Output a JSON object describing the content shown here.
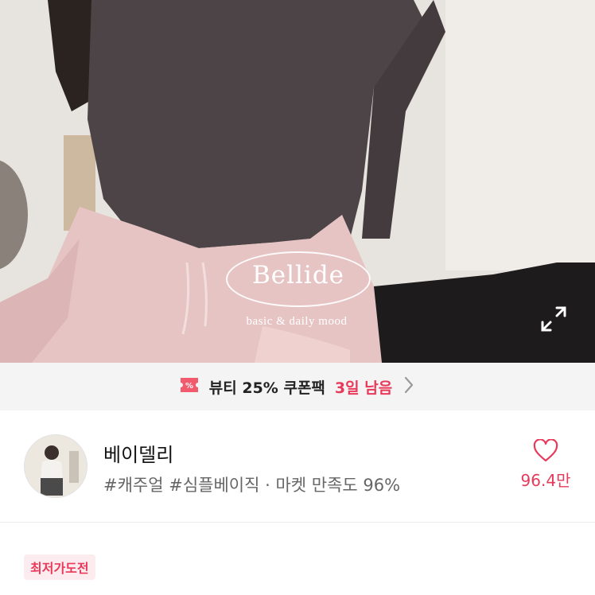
{
  "product_image": {
    "brand_logo": "Bellide",
    "brand_tagline": "basic & daily mood",
    "expand_icon": "expand-icon"
  },
  "coupon_banner": {
    "icon": "coupon-icon",
    "label": "뷰티 25% 쿠폰팩",
    "time_left": "3일 남음",
    "chevron": "chevron-right-icon",
    "accent_color": "#e8395a"
  },
  "store": {
    "name": "베이델리",
    "tags": "#캐주얼 #심플베이직 · 마켓 만족도 96%",
    "like_count": "96.4만",
    "like_icon": "heart-outline-icon"
  },
  "badges": {
    "lowest_price": "최저가도전"
  }
}
